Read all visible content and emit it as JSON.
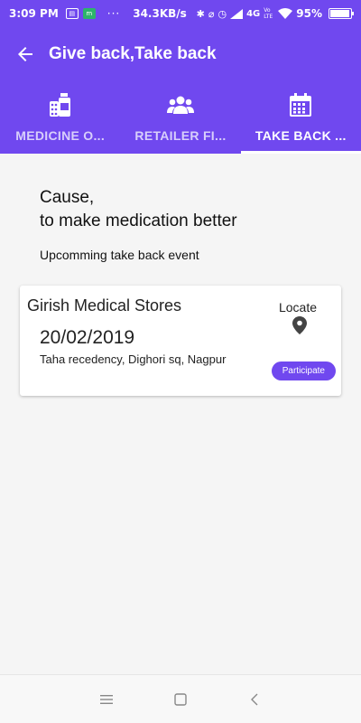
{
  "status_bar": {
    "time": "3:09 PM",
    "dots": "···",
    "net_speed": "34.3KB/s",
    "network": "4G",
    "volte": "Vo LTE",
    "battery_percent": "95%",
    "battery_level": 0.95
  },
  "app_bar": {
    "title": "Give back,Take back",
    "back_icon": "arrow-left-icon"
  },
  "tabs": [
    {
      "label": "MEDICINE O...",
      "icon": "medicine-icon",
      "active": false
    },
    {
      "label": "RETAILER FI...",
      "icon": "people-icon",
      "active": false
    },
    {
      "label": "TAKE BACK ...",
      "icon": "calendar-icon",
      "active": true
    }
  ],
  "content": {
    "heading_line1": "Cause,",
    "heading_line2": "to make medication better",
    "subheading": "Upcomming take back event"
  },
  "event_card": {
    "store_name": "Girish Medical Stores",
    "date": "20/02/2019",
    "address": "Taha recedency, Dighori sq, Nagpur",
    "locate_label": "Locate",
    "participate_label": "Participate"
  },
  "colors": {
    "primary": "#7048ef",
    "tab_inactive_text": "#d8cffb",
    "white": "#ffffff"
  }
}
